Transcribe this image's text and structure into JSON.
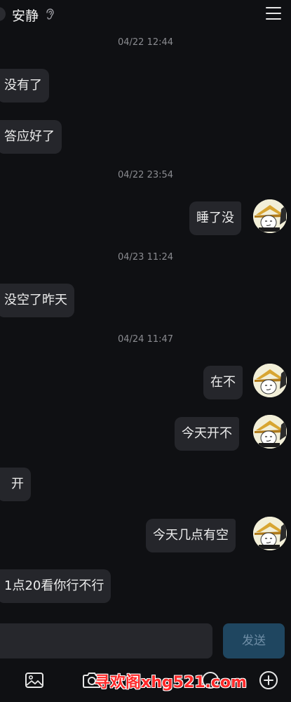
{
  "header": {
    "title": "安静"
  },
  "messages": [
    {
      "type": "timestamp",
      "text": "04/22 12:44"
    },
    {
      "type": "received",
      "text": "没有了"
    },
    {
      "type": "received",
      "text": "答应好了"
    },
    {
      "type": "timestamp",
      "text": "04/22 23:54"
    },
    {
      "type": "sent",
      "text": "睡了没"
    },
    {
      "type": "timestamp",
      "text": "04/23 11:24"
    },
    {
      "type": "received",
      "text": "没空了昨天"
    },
    {
      "type": "timestamp",
      "text": "04/24 11:47"
    },
    {
      "type": "sent",
      "text": "在不"
    },
    {
      "type": "sent",
      "text": "今天开不"
    },
    {
      "type": "received",
      "text": "开"
    },
    {
      "type": "sent",
      "text": "今天几点有空"
    },
    {
      "type": "received",
      "text": "1点20看你行不行"
    }
  ],
  "composer": {
    "send_label": "发送"
  },
  "toolbar": {
    "icons": [
      "image-icon",
      "camera-icon",
      "more-icon",
      "add-icon"
    ]
  },
  "watermark": {
    "text": "寻欢阁xhg521.com"
  },
  "colors": {
    "background": "#0f1013",
    "bubble": "#25262b",
    "send_button": "#1f4660",
    "watermark": "#ff2a2a"
  }
}
